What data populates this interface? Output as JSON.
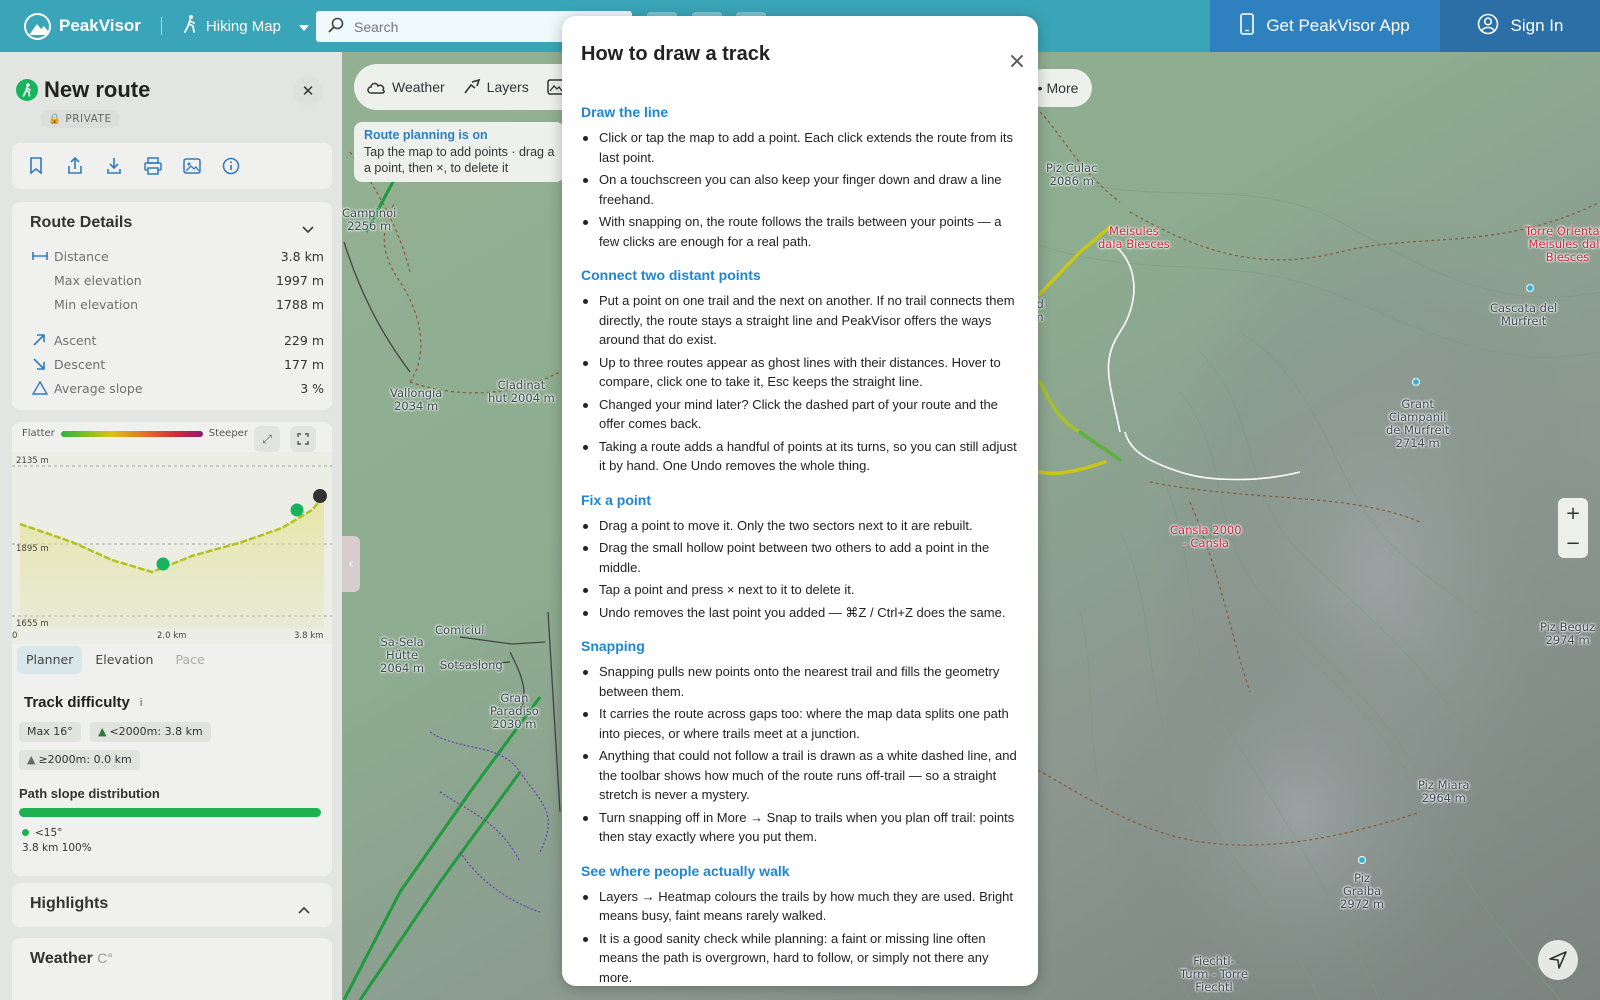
{
  "topbar": {
    "brand": "PeakVisor",
    "mode": "Hiking Map",
    "search_placeholder": "Search",
    "get_app": "Get PeakVisor App",
    "sign_in": "Sign In"
  },
  "panel": {
    "route_title": "New route",
    "privacy": "PRIVATE",
    "details_title": "Route Details",
    "details": [
      {
        "label": "Distance",
        "value": "3.8 km"
      },
      {
        "label": "Max elevation",
        "value": "1997 m"
      },
      {
        "label": "Min elevation",
        "value": "1788 m"
      },
      {
        "label": "Ascent",
        "value": "229 m"
      },
      {
        "label": "Descent",
        "value": "177 m"
      },
      {
        "label": "Average slope",
        "value": "3 %"
      }
    ],
    "profile": {
      "flatter": "Flatter",
      "steeper": "Steeper",
      "y_top": "2135 m",
      "y_mid": "1895 m",
      "y_bottom": "1655 m",
      "x_start": "0",
      "x_mid": "2.0 km",
      "x_end": "3.8 km"
    },
    "tabs": [
      "Planner",
      "Elevation",
      "Pace"
    ],
    "difficulty_title": "Track difficulty",
    "difficulty_info": "i",
    "chips": [
      "Max 16°",
      "<2000m: 3.8 km",
      "≥2000m: 0.0 km"
    ],
    "slope_title": "Path slope distribution",
    "slope_legend_label": "<15°",
    "slope_legend_value": "3.8 km 100%",
    "highlights_title": "Highlights",
    "weather_title": "Weather",
    "weather_unit": "C°"
  },
  "map": {
    "toolbar": [
      "Weather",
      "Layers"
    ],
    "more": "More",
    "planning_title": "Route planning is on",
    "planning_line1": "Tap the map to add points · drag a",
    "planning_line2": "a point, then ×, to delete it",
    "labels": [
      {
        "text": "Campinoi\n2256 m"
      },
      {
        "text": "Vallongia\n2034 m"
      },
      {
        "text": "Cladinat\nhut 2004 m"
      },
      {
        "text": "Sa-Sela\nHütte\n2064 m"
      },
      {
        "text": "Gran\nParadiso\n2030 m"
      },
      {
        "text": "Comiciul"
      },
      {
        "text": "Sotsaslong"
      },
      {
        "text": "Piz Culac\n2086 m"
      },
      {
        "text": "Meisules\ndala Biesces"
      },
      {
        "text": "Torre Orientale\nMeisules dala\nBiesces"
      },
      {
        "text": "Cascata del\nMurfreit"
      },
      {
        "text": "Grant\nCiampanil\nde Murfreit\n2714 m"
      },
      {
        "text": "Cansla 2000\n- Cansla"
      },
      {
        "text": "Piz Beguz\n2974 m"
      },
      {
        "text": "Piz Miara\n2964 m"
      },
      {
        "text": "Piz\nGralba\n2972 m"
      },
      {
        "text": "Fiechtl-\nTurm - Torre\nFiechtl"
      },
      {
        "text": "rd\nm"
      }
    ]
  },
  "modal": {
    "title": "How to draw a track",
    "sections": [
      {
        "heading": "Draw the line",
        "items": [
          "Click or tap the map to add a point. Each click extends the route from its last point.",
          "On a touchscreen you can also keep your finger down and draw a line freehand.",
          "With snapping on, the route follows the trails between your points — a few clicks are enough for a real path."
        ]
      },
      {
        "heading": "Connect two distant points",
        "items": [
          "Put a point on one trail and the next on another. If no trail connects them directly, the route stays a straight line and PeakVisor offers the ways around that do exist.",
          "Up to three routes appear as ghost lines with their distances. Hover to compare, click one to take it, Esc keeps the straight line.",
          "Changed your mind later? Click the dashed part of your route and the offer comes back.",
          "Taking a route adds a handful of points at its turns, so you can still adjust it by hand. One Undo removes the whole thing."
        ]
      },
      {
        "heading": "Fix a point",
        "items": [
          "Drag a point to move it. Only the two sectors next to it are rebuilt.",
          "Drag the small hollow point between two others to add a point in the middle.",
          "Tap a point and press × next to it to delete it.",
          "Undo removes the last point you added — ⌘Z / Ctrl+Z does the same."
        ]
      },
      {
        "heading": "Snapping",
        "items": [
          "Snapping pulls new points onto the nearest trail and fills the geometry between them.",
          "It carries the route across gaps too: where the map data splits one path into pieces, or where trails meet at a junction.",
          "Anything that could not follow a trail is drawn as a white dashed line, and the toolbar shows how much of the route runs off-trail — so a straight stretch is never a mystery.",
          "Turn snapping off in More → Snap to trails when you plan off trail: points then stay exactly where you put them."
        ]
      },
      {
        "heading": "See where people actually walk",
        "items": [
          "Layers → Heatmap colours the trails by how much they are used. Bright means busy, faint means rarely walked.",
          "It is a good sanity check while planning: a faint or missing line often means the path is overgrown, hard to follow, or simply not there any more."
        ]
      }
    ]
  },
  "colors": {
    "topbar": "#3aa5b8",
    "get_app": "#2f80bf",
    "modal_heading": "#1f86d2",
    "route_green": "#19b25f"
  }
}
